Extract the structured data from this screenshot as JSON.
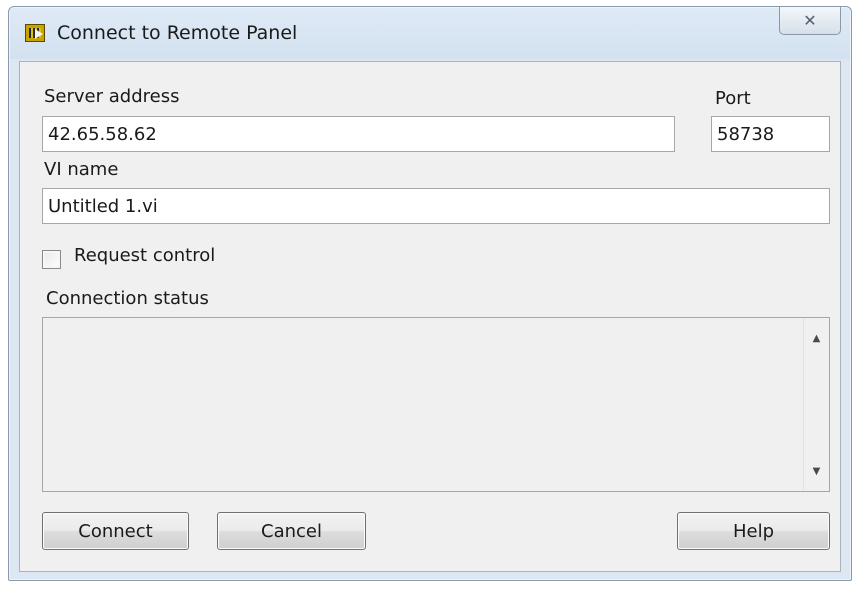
{
  "window": {
    "title": "Connect to Remote Panel",
    "close_glyph": "✕",
    "icon": "labview-app-icon"
  },
  "form": {
    "server_address_label": "Server address",
    "server_address_value": "42.65.58.62",
    "port_label": "Port",
    "port_value": "58738",
    "vi_name_label": "VI name",
    "vi_name_value": "Untitled 1.vi",
    "request_control_label": "Request control",
    "request_control_checked": false,
    "connection_status_label": "Connection status",
    "connection_status_text": ""
  },
  "scrollbar": {
    "up_glyph": "▲",
    "down_glyph": "▼"
  },
  "buttons": {
    "connect_label": "Connect",
    "cancel_label": "Cancel",
    "help_label": "Help"
  },
  "colors": {
    "titlebar": "#d3e1f0",
    "client_bg": "#f0f0f0",
    "field_bg": "#ffffff"
  }
}
